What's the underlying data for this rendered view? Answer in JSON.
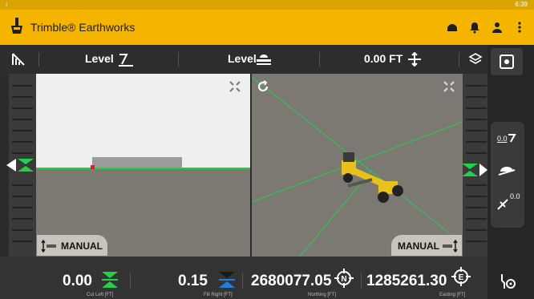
{
  "status": {
    "left_glyph": "↓",
    "time": "6:39"
  },
  "app": {
    "title": "Trimble® Earthworks"
  },
  "toolbar": {
    "left_mode_label": "Level",
    "center_mode_label": "Level",
    "offset_label": "0.00 FT"
  },
  "views": {
    "left_manual_label": "MANUAL",
    "right_manual_label": "MANUAL"
  },
  "readout": {
    "cut_left": {
      "value": "0.00",
      "label": "Cut Left [FT]"
    },
    "fill_right": {
      "value": "0.15",
      "label": "Fill Right [FT]"
    },
    "northing": {
      "value": "2680077.05",
      "label": "Northing [FT]"
    },
    "easting": {
      "value": "1285261.30",
      "label": "Easting [FT]"
    }
  },
  "rail": {
    "zoom_label": "0.0",
    "tilt_label": "0.0"
  },
  "colors": {
    "brand": "#f5b400",
    "ok_green": "#22d04a",
    "fill_blue": "#1e7fe0"
  }
}
